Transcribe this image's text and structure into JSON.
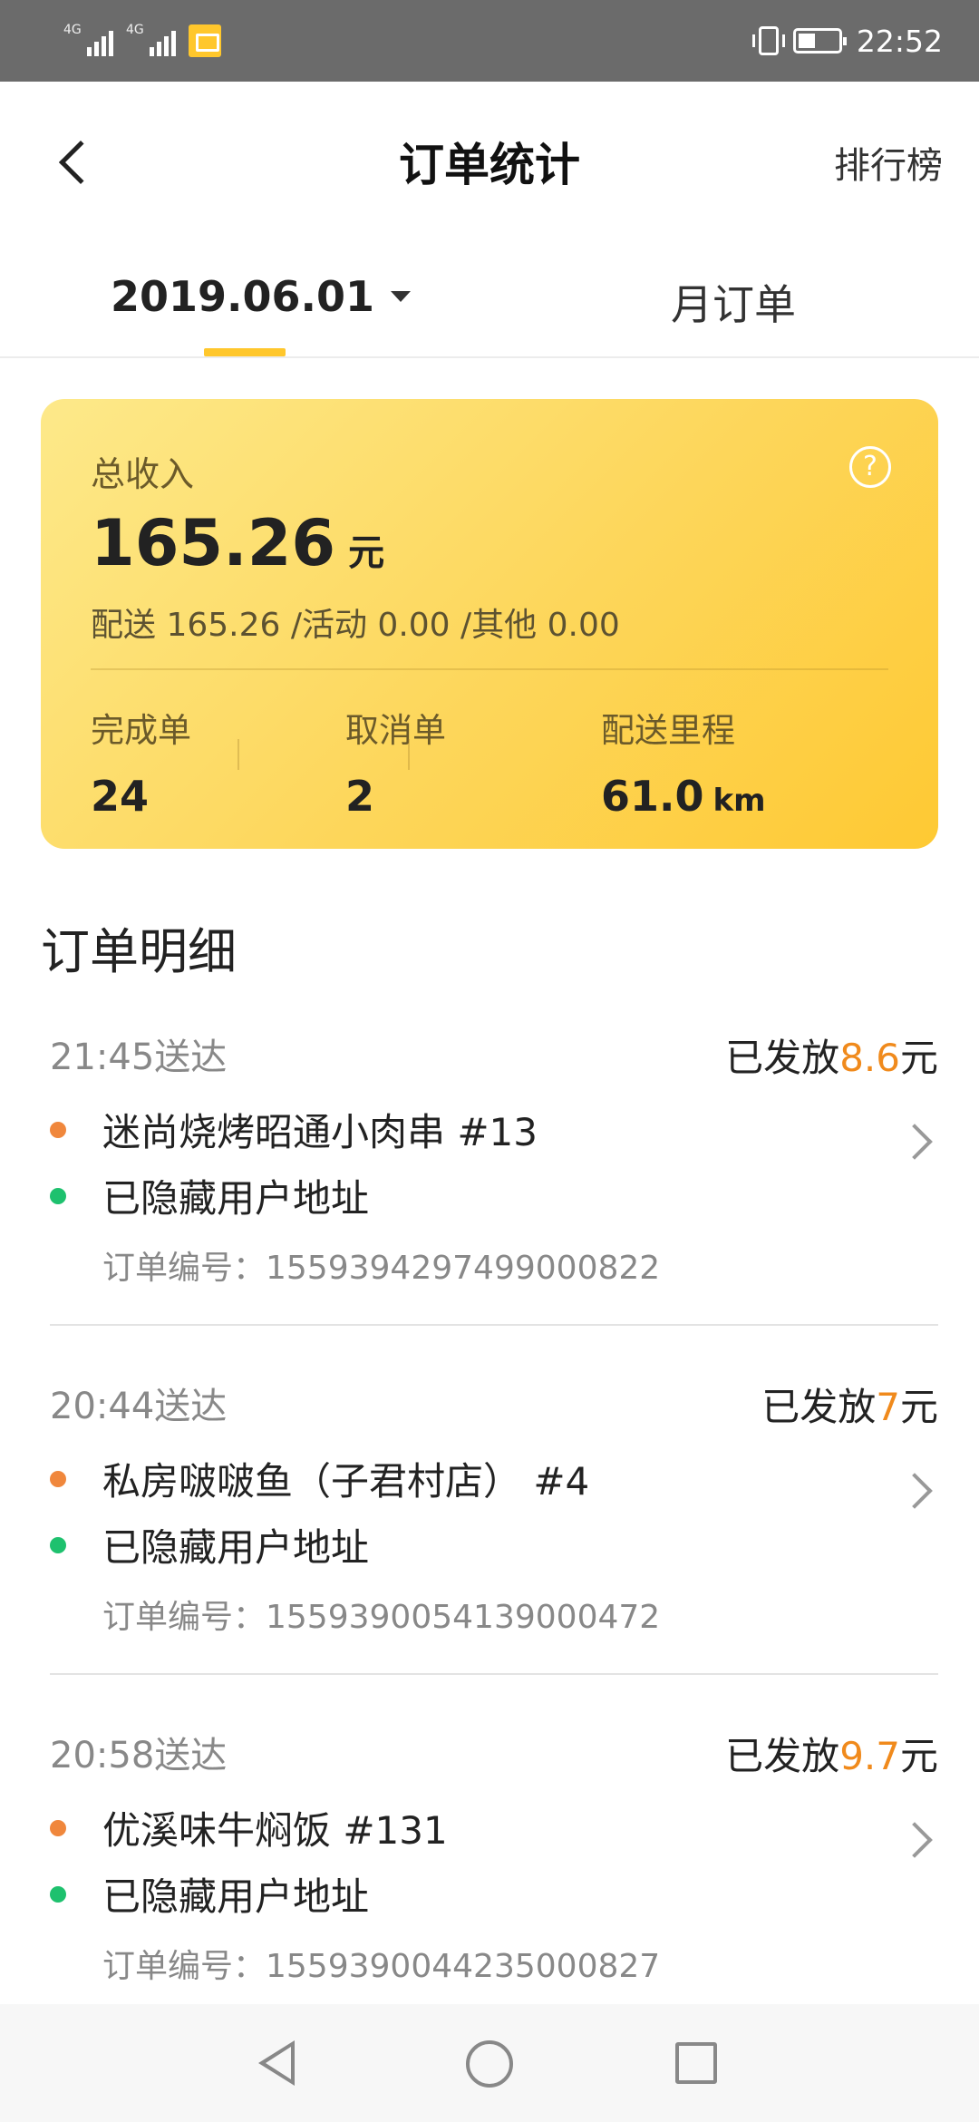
{
  "status_bar": {
    "network_1": "4G",
    "network_2": "4G",
    "time": "22:52",
    "icons": [
      "signal-icon",
      "signal-icon",
      "app-notification-icon",
      "vibrate-icon",
      "battery-icon"
    ]
  },
  "header": {
    "title": "订单统计",
    "right_action": "排行榜"
  },
  "tabs": {
    "date_label": "2019.06.01",
    "month_label": "月订单",
    "active": "date"
  },
  "summary": {
    "total_label": "总收入",
    "total_value": "165.26",
    "total_unit": "元",
    "breakdown": "配送 165.26  /活动 0.00  /其他 0.00",
    "stats": [
      {
        "label": "完成单",
        "value": "24",
        "unit": ""
      },
      {
        "label": "取消单",
        "value": "2",
        "unit": ""
      },
      {
        "label": "配送里程",
        "value": "61.0",
        "unit": "km"
      }
    ]
  },
  "orders_section": {
    "title": "订单明细",
    "paid_prefix": "已发放",
    "paid_suffix": "元",
    "orders": [
      {
        "time": "21:45送达",
        "amount": "8.6",
        "store": "迷尚烧烤昭通小肉串 #13",
        "address": "已隐藏用户地址",
        "order_no": "订单编号：1559394297499000822"
      },
      {
        "time": "20:44送达",
        "amount": "7",
        "store": "私房啵啵鱼（子君村店） #4",
        "address": "已隐藏用户地址",
        "order_no": "订单编号：1559390054139000472"
      },
      {
        "time": "20:58送达",
        "amount": "9.7",
        "store": "优溪味牛焖饭 #131",
        "address": "已隐藏用户地址",
        "order_no": "订单编号：1559390044235000827"
      }
    ]
  },
  "colors": {
    "accent_yellow": "#ffc72c",
    "amount_orange": "#f08a1c",
    "dot_orange": "#f0873c",
    "dot_green": "#1ec16e"
  }
}
